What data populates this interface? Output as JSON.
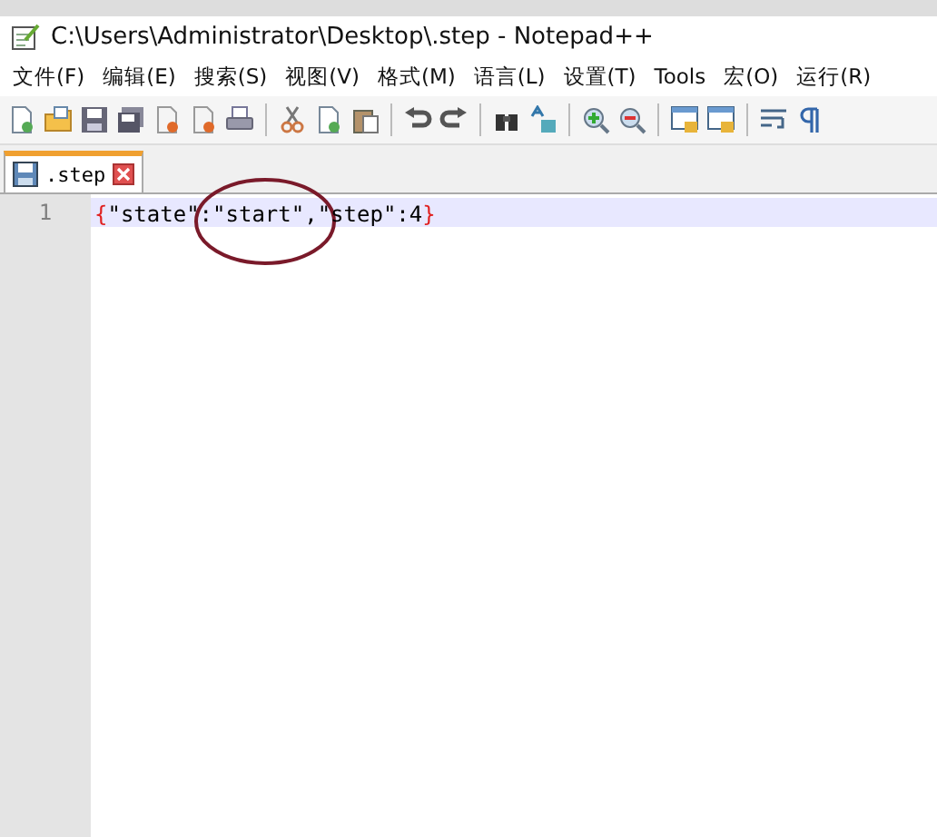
{
  "window": {
    "title": "C:\\Users\\Administrator\\Desktop\\.step - Notepad++"
  },
  "menu": [
    "文件(F)",
    "编辑(E)",
    "搜索(S)",
    "视图(V)",
    "格式(M)",
    "语言(L)",
    "设置(T)",
    "Tools",
    "宏(O)",
    "运行(R)"
  ],
  "tabs": [
    {
      "label": ".step",
      "selected": true
    }
  ],
  "editor": {
    "lines": [
      {
        "number": "1",
        "current": true,
        "tokens": [
          {
            "kind": "brace",
            "text": "{"
          },
          {
            "kind": "text",
            "text": "\"state\":\"start\",\"step\":4"
          },
          {
            "kind": "brace",
            "text": "}"
          }
        ]
      }
    ]
  }
}
